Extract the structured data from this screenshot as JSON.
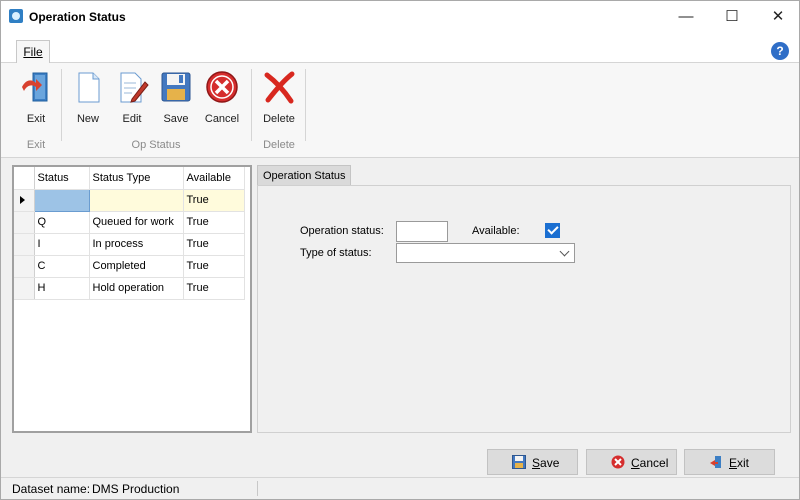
{
  "window": {
    "title": "Operation Status"
  },
  "ribbon": {
    "tab_file": "File",
    "buttons": {
      "exit": "Exit",
      "new": "New",
      "edit": "Edit",
      "save": "Save",
      "cancel": "Cancel",
      "delete": "Delete"
    },
    "groups": {
      "exit": "Exit",
      "op_status": "Op Status",
      "delete": "Delete"
    }
  },
  "grid": {
    "columns": [
      "Status",
      "Status Type",
      "Available"
    ],
    "rows": [
      {
        "status": "",
        "type": "",
        "available": "True"
      },
      {
        "status": "Q",
        "type": "Queued for work",
        "available": "True"
      },
      {
        "status": "I",
        "type": "In process",
        "available": "True"
      },
      {
        "status": "C",
        "type": "Completed",
        "available": "True"
      },
      {
        "status": "H",
        "type": "Hold operation",
        "available": "True"
      }
    ]
  },
  "detail": {
    "tab": "Operation Status",
    "operation_status_label": "Operation status:",
    "operation_status_value": "",
    "available_label": "Available:",
    "available_checked": true,
    "type_label": "Type of status:",
    "type_value": ""
  },
  "footer": {
    "save": "Save",
    "cancel": "Cancel",
    "exit": "Exit"
  },
  "statusbar": {
    "label": "Dataset name:",
    "value": "DMS Production"
  },
  "colors": {
    "accent": "#1b6fd1",
    "selected_row": "#fffbdc",
    "edit_cell": "#9dc3e6"
  }
}
